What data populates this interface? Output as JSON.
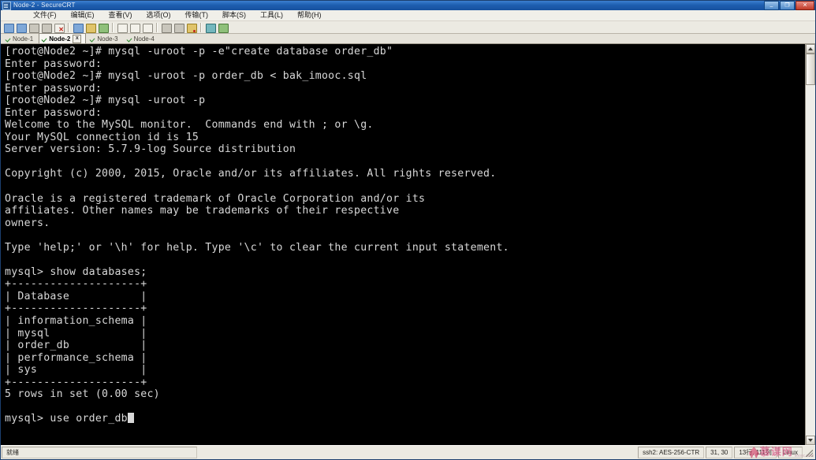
{
  "window": {
    "title": "Node-2 - SecureCRT",
    "icon": "securecrt-icon",
    "minimize_label": "–",
    "restore_label": "❐",
    "close_label": "✕"
  },
  "menubar": {
    "items": [
      {
        "label": "文件(F)",
        "name": "menu-file"
      },
      {
        "label": "编辑(E)",
        "name": "menu-edit"
      },
      {
        "label": "查看(V)",
        "name": "menu-view"
      },
      {
        "label": "选项(O)",
        "name": "menu-options"
      },
      {
        "label": "传输(T)",
        "name": "menu-transfer"
      },
      {
        "label": "脚本(S)",
        "name": "menu-script"
      },
      {
        "label": "工具(L)",
        "name": "menu-tools"
      },
      {
        "label": "帮助(H)",
        "name": "menu-help"
      }
    ]
  },
  "toolbar": {
    "buttons": [
      {
        "name": "new-session-icon",
        "style": "g-blue",
        "badge": ""
      },
      {
        "name": "clone-session-icon",
        "style": "g-blue",
        "badge": ""
      },
      {
        "name": "connect-icon",
        "style": "g-grey",
        "badge": ""
      },
      {
        "name": "connect-local-icon",
        "style": "g-grey",
        "badge": ""
      },
      {
        "name": "disconnect-icon",
        "style": "g-white",
        "badge": "x"
      },
      {
        "name": "sep-1",
        "style": "sep",
        "badge": ""
      },
      {
        "name": "copy-icon",
        "style": "g-blue",
        "badge": ""
      },
      {
        "name": "paste-icon",
        "style": "g-yellow",
        "badge": ""
      },
      {
        "name": "find-icon",
        "style": "g-green",
        "badge": ""
      },
      {
        "name": "sep-2",
        "style": "sep",
        "badge": ""
      },
      {
        "name": "print-icon",
        "style": "g-white",
        "badge": ""
      },
      {
        "name": "log-session-icon",
        "style": "g-white",
        "badge": ""
      },
      {
        "name": "clear-screen-icon",
        "style": "g-white",
        "badge": ""
      },
      {
        "name": "sep-3",
        "style": "sep",
        "badge": ""
      },
      {
        "name": "session-options-icon",
        "style": "g-grey",
        "badge": ""
      },
      {
        "name": "global-options-icon",
        "style": "g-grey",
        "badge": ""
      },
      {
        "name": "key-icon",
        "style": "g-yellow",
        "badge": "dot"
      },
      {
        "name": "sep-4",
        "style": "sep",
        "badge": ""
      },
      {
        "name": "help-icon",
        "style": "g-teal",
        "badge": ""
      },
      {
        "name": "about-icon",
        "style": "g-green",
        "badge": ""
      }
    ]
  },
  "tabs": {
    "items": [
      {
        "label": "Node-1",
        "active": false,
        "name": "tab-node-1"
      },
      {
        "label": "Node-2",
        "active": true,
        "name": "tab-node-2"
      },
      {
        "label": "Node-3",
        "active": false,
        "name": "tab-node-3"
      },
      {
        "label": "Node-4",
        "active": false,
        "name": "tab-node-4"
      }
    ],
    "close_label": "x"
  },
  "terminal": {
    "lines": [
      "[root@Node2 ~]# mysql -uroot -p -e\"create database order_db\"",
      "Enter password:",
      "[root@Node2 ~]# mysql -uroot -p order_db < bak_imooc.sql",
      "Enter password:",
      "[root@Node2 ~]# mysql -uroot -p",
      "Enter password:",
      "Welcome to the MySQL monitor.  Commands end with ; or \\g.",
      "Your MySQL connection id is 15",
      "Server version: 5.7.9-log Source distribution",
      "",
      "Copyright (c) 2000, 2015, Oracle and/or its affiliates. All rights reserved.",
      "",
      "Oracle is a registered trademark of Oracle Corporation and/or its",
      "affiliates. Other names may be trademarks of their respective",
      "owners.",
      "",
      "Type 'help;' or '\\h' for help. Type '\\c' to clear the current input statement.",
      "",
      "mysql> show databases;",
      "+--------------------+",
      "| Database           |",
      "+--------------------+",
      "| information_schema |",
      "| mysql              |",
      "| order_db           |",
      "| performance_schema |",
      "| sys                |",
      "+--------------------+",
      "5 rows in set (0.00 sec)",
      "",
      "mysql> use order_db"
    ],
    "foreground": "#d8d8d8",
    "background": "#000000"
  },
  "statusbar": {
    "ready": "就绪",
    "protocol": "ssh2: AES-256-CTR",
    "position": "31, 30",
    "size": "13行, 111列",
    "emulation": "Linux",
    "watermark_text": "慕课网",
    "watermark_sub": "imooc.com"
  }
}
